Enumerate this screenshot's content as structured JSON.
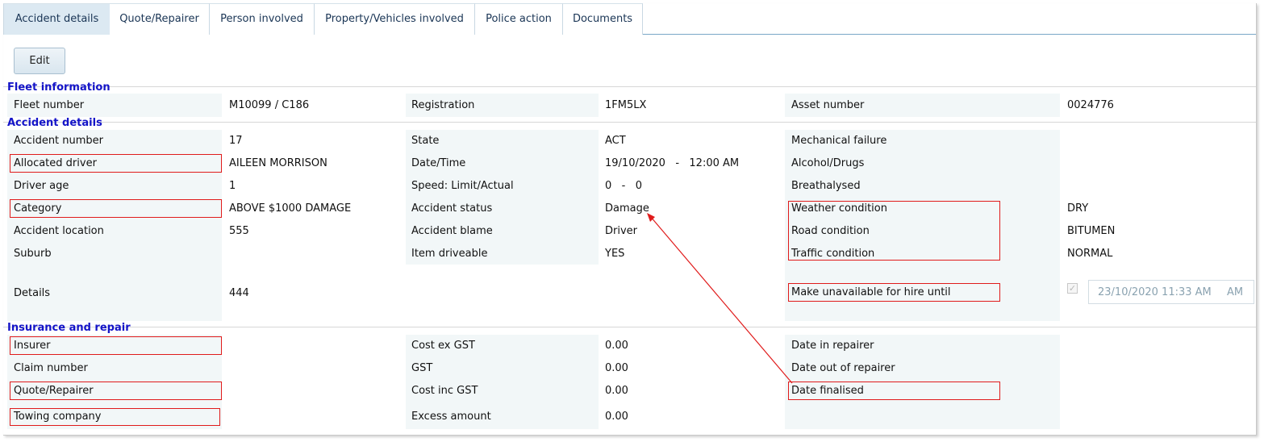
{
  "tabs": [
    "Accident details",
    "Quote/Repairer",
    "Person involved",
    "Property/Vehicles involved",
    "Police action",
    "Documents"
  ],
  "edit_label": "Edit",
  "fleet": {
    "title": "Fleet information",
    "fleet_number_label": "Fleet number",
    "fleet_number_value": "M10099 / C186",
    "registration_label": "Registration",
    "registration_value": "1FM5LX",
    "asset_number_label": "Asset number",
    "asset_number_value": "0024776"
  },
  "accident": {
    "title": "Accident details",
    "accident_number_label": "Accident number",
    "accident_number_value": "17",
    "allocated_driver_label": "Allocated driver",
    "allocated_driver_value": "AILEEN MORRISON",
    "driver_age_label": "Driver age",
    "driver_age_value": "1",
    "category_label": "Category",
    "category_value": "ABOVE $1000 DAMAGE",
    "accident_location_label": "Accident location",
    "accident_location_value": "555",
    "suburb_label": "Suburb",
    "details_label": "Details",
    "details_value": "444",
    "state_label": "State",
    "state_value": "ACT",
    "datetime_label": "Date/Time",
    "datetime_value": "19/10/2020   -   12:00 AM",
    "speed_label": "Speed: Limit/Actual",
    "speed_value": "0   -   0",
    "status_label": "Accident status",
    "status_value": "Damage",
    "blame_label": "Accident blame",
    "blame_value": "Driver",
    "driveable_label": "Item driveable",
    "driveable_value": "YES",
    "mechanical_label": "Mechanical failure",
    "alcohol_label": "Alcohol/Drugs",
    "breathalysed_label": "Breathalysed",
    "weather_label": "Weather condition",
    "weather_value": "DRY",
    "road_label": "Road condition",
    "road_value": "BITUMEN",
    "traffic_label": "Traffic condition",
    "traffic_value": "NORMAL",
    "unavailable_label": "Make unavailable for hire until",
    "unavailable_value": "23/10/2020 11:33 AM",
    "unavailable_ghost": "AM"
  },
  "insurance": {
    "title": "Insurance and repair",
    "insurer_label": "Insurer",
    "claim_number_label": "Claim number",
    "quote_repairer_label": "Quote/Repairer",
    "towing_label": "Towing company",
    "cost_ex_gst_label": "Cost ex GST",
    "cost_ex_gst_value": "0.00",
    "gst_label": "GST",
    "gst_value": "0.00",
    "cost_inc_gst_label": "Cost inc GST",
    "cost_inc_gst_value": "0.00",
    "excess_label": "Excess amount",
    "excess_value": "0.00",
    "date_in_label": "Date in repairer",
    "date_out_label": "Date out of repairer",
    "date_finalised_label": "Date finalised"
  },
  "colors": {
    "highlight": "#e01b1b",
    "section_title": "#1414c8",
    "active_tab": "#dce9f2"
  }
}
